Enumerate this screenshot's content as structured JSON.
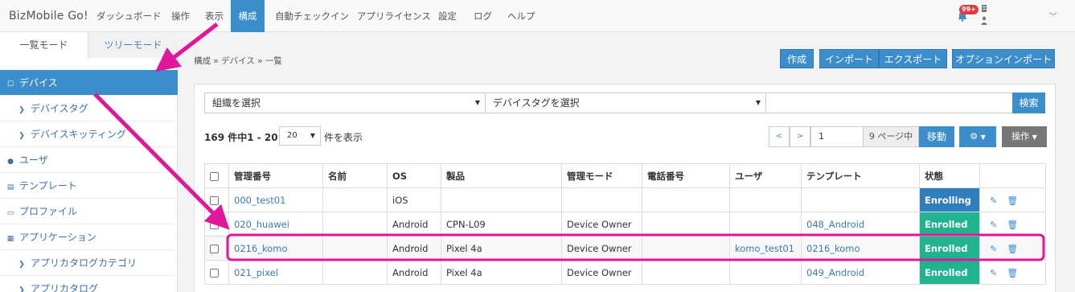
{
  "app": {
    "brand": "BizMobile Go!"
  },
  "nav": {
    "items": [
      "ダッシュボード",
      "操作",
      "表示",
      "構成",
      "自動チェックイン",
      "アプリライセンス",
      "設定",
      "ログ",
      "ヘルプ"
    ],
    "notification_count": "99+"
  },
  "sidebar": {
    "tabs": [
      "一覧モード",
      "ツリーモード"
    ],
    "items": [
      {
        "label": "デバイス",
        "icon": "square-icon"
      },
      {
        "label": "デバイスタグ",
        "icon": "chevron-right-icon"
      },
      {
        "label": "デバイスキッティング",
        "icon": "chevron-right-icon"
      },
      {
        "label": "ユーザ",
        "icon": "user-icon"
      },
      {
        "label": "テンプレート",
        "icon": "file-icon"
      },
      {
        "label": "プロファイル",
        "icon": "hdd-icon"
      },
      {
        "label": "アプリケーション",
        "icon": "grid-icon"
      },
      {
        "label": "アプリカタログカテゴリ",
        "icon": "chevron-right-icon"
      },
      {
        "label": "アプリカタログ",
        "icon": "chevron-right-icon"
      }
    ]
  },
  "breadcrumb": "構成 » デバイス » 一覧",
  "toolbar": {
    "create": "作成",
    "import": "インポート",
    "export": "エクスポート",
    "option_import": "オプションインポート"
  },
  "filters": {
    "org_select": "組織を選択",
    "tag_select": "デバイスタグを選択",
    "search_value": "",
    "search_button": "検索"
  },
  "listing": {
    "count_text": "169 件中1 - 20 件",
    "per_page": "20",
    "per_page_suffix": "件を表示"
  },
  "pager": {
    "prev": "<",
    "next": ">",
    "page": "1",
    "total_text": "9 ページ中",
    "go": "移動",
    "operation": "操作"
  },
  "table": {
    "headers": [
      "管理番号",
      "名前",
      "OS",
      "製品",
      "管理モード",
      "電話番号",
      "ユーザ",
      "テンプレート",
      "状態"
    ],
    "rows": [
      {
        "id": "000_test01",
        "name": "",
        "os": "iOS",
        "product": "",
        "mode": "",
        "phone": "",
        "user": "",
        "template": "",
        "status": "Enrolling"
      },
      {
        "id": "020_huawei",
        "name": "",
        "os": "Android",
        "product": "CPN-L09",
        "mode": "Device Owner",
        "phone": "",
        "user": "",
        "template": "048_Android",
        "status": "Enrolled"
      },
      {
        "id": "0216_komo",
        "name": "",
        "os": "Android",
        "product": "Pixel 4a",
        "mode": "Device Owner",
        "phone": "",
        "user": "komo_test01",
        "template": "0216_komo",
        "status": "Enrolled"
      },
      {
        "id": "021_pixel",
        "name": "",
        "os": "Android",
        "product": "Pixel 4a",
        "mode": "Device Owner",
        "phone": "",
        "user": "",
        "template": "049_Android",
        "status": "Enrolled"
      }
    ]
  },
  "colors": {
    "primary": "#3c8dcc",
    "enrolling": "#2f7fbf",
    "enrolled": "#1fb48f",
    "annotation": "#e0179a",
    "badge": "#e8383d"
  }
}
